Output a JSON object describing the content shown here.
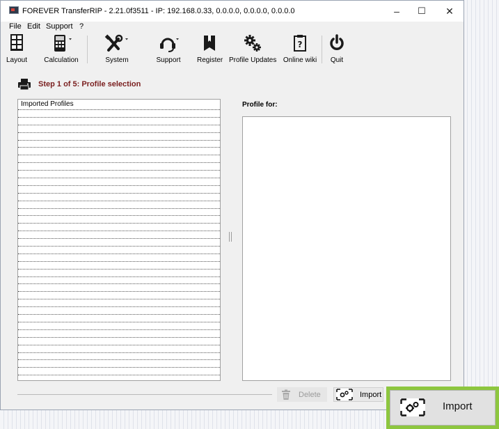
{
  "window": {
    "title": "FOREVER TransferRIP - 2.21.0f3511 - IP: 192.168.0.33, 0.0.0.0, 0.0.0.0, 0.0.0.0",
    "controls": {
      "minimize": "–",
      "maximize": "☐",
      "close": "✕"
    }
  },
  "menu": [
    "File",
    "Edit",
    "Support",
    "?"
  ],
  "toolbar": [
    {
      "label": "Layout",
      "icon": "layout-icon"
    },
    {
      "label": "Calculation",
      "icon": "calculator-icon"
    },
    {
      "label": "System",
      "icon": "tools-icon"
    },
    {
      "label": "Support",
      "icon": "headset-icon"
    },
    {
      "label": "Register",
      "icon": "book-icon"
    },
    {
      "label": "Profile Updates",
      "icon": "gears-icon"
    },
    {
      "label": "Online wiki",
      "icon": "clipboard-question-icon"
    },
    {
      "label": "Quit",
      "icon": "power-icon"
    }
  ],
  "step": {
    "text": "Step 1 of 5: Profile selection",
    "icon": "printer-icon"
  },
  "profiles": {
    "header": "Imported Profiles",
    "rows": []
  },
  "profile_for": {
    "label": "Profile for:"
  },
  "buttons": {
    "delete": "Delete",
    "import": "Import"
  },
  "callout": {
    "label": "Import"
  },
  "colors": {
    "step_text": "#7a1f1f",
    "callout_border": "#8dc63f",
    "disabled_text": "#9b9b9b"
  }
}
